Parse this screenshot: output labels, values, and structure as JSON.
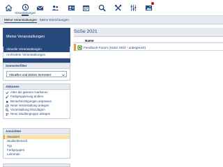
{
  "topnav": {
    "items": [
      {
        "icon": "home-icon"
      },
      {
        "icon": "courses-icon",
        "label": "Veranstaltungen",
        "active": true
      },
      {
        "icon": "mail-icon"
      },
      {
        "icon": "community-icon"
      },
      {
        "icon": "profile-icon"
      },
      {
        "icon": "calendar-icon"
      },
      {
        "icon": "search-icon"
      },
      {
        "icon": "tools-icon"
      },
      {
        "icon": "admin-icon"
      },
      {
        "icon": "photo-icon"
      }
    ],
    "active_label": "Veranstaltungen"
  },
  "subtabs": [
    {
      "label": "Meine Veranstaltungen",
      "active": true
    },
    {
      "label": "Meine Einrichtungen",
      "active": false
    }
  ],
  "sidebar": {
    "title": "Meine Veranstaltungen",
    "nav": [
      {
        "label": "Aktuelle Veranstaltungen",
        "active": true
      },
      {
        "label": "Archivierte Veranstaltungen",
        "active": false
      }
    ],
    "filter": {
      "title": "Semesterfilter",
      "value": "Aktuelles und letztes Semester"
    },
    "actions": {
      "title": "Aktionen",
      "items": [
        {
          "label": "Alles als gelesen markieren",
          "icon": "check-icon"
        },
        {
          "label": "Farbgruppierung ändern",
          "icon": "brush-icon"
        },
        {
          "label": "Benachrichtigungen anpassen",
          "icon": "bell-icon"
        },
        {
          "label": "Neue Veranstaltung anlegen",
          "icon": "add-course-icon"
        },
        {
          "label": "Veranstaltung hinzufügen",
          "icon": "search-plus-icon"
        },
        {
          "label": "Neue Studiengruppe anlegen",
          "icon": "add-group-icon"
        }
      ]
    },
    "views": {
      "title": "Ansichten",
      "items": [
        {
          "label": "Standard",
          "active": true
        },
        {
          "label": "Studienbereich",
          "active": false
        },
        {
          "label": "Typ",
          "active": false
        },
        {
          "label": "Farbgruppen",
          "active": false
        },
        {
          "label": "Lehrende",
          "active": false
        }
      ]
    }
  },
  "main": {
    "semester": "SoSe 2021",
    "column_name": "Name",
    "courses": [
      {
        "name": "Feedback-Forum (SoSe 2004 - unbegrenzt)",
        "color": "#f0933a"
      }
    ]
  },
  "colors": {
    "brand": "#28497c",
    "panel": "#e7ebf1",
    "highlight": "#fbe3a8",
    "course_stripe": "#f0933a",
    "forum_icon": "#5aa02c"
  }
}
